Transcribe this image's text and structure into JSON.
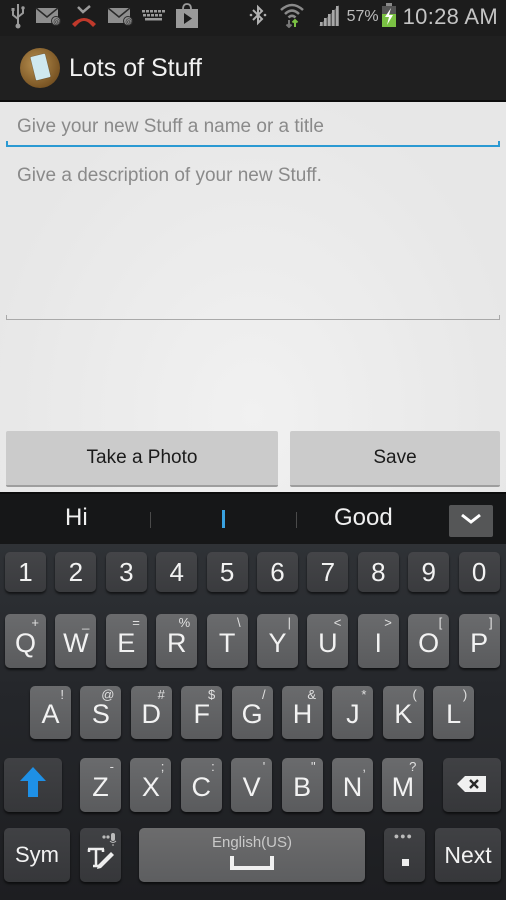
{
  "status_bar": {
    "left_icons": [
      "usb-icon",
      "email-icon",
      "missed-call-icon",
      "email-icon",
      "keyboard-icon",
      "play-store-icon"
    ],
    "right_icons": [
      "bluetooth-icon",
      "wifi-icon",
      "signal-icon",
      "battery-charging-icon"
    ],
    "battery_percent": "57%",
    "time": "10:28 AM",
    "colors": {
      "missed_call": "#c0392b",
      "battery": "#7ac143"
    }
  },
  "action_bar": {
    "title": "Lots of Stuff",
    "icon": "app-icon"
  },
  "form": {
    "title_field": {
      "value": "",
      "placeholder": "Give your new Stuff a name or a title",
      "focused": true
    },
    "description_field": {
      "value": "",
      "placeholder": "Give a description of your new Stuff."
    },
    "take_photo_label": "Take a Photo",
    "save_label": "Save",
    "accent_color": "#2b9ad3"
  },
  "suggestions": {
    "items": [
      "Hi",
      "I",
      "Good"
    ],
    "collapse_icon": "chevron-down-icon"
  },
  "keyboard": {
    "number_row": [
      "1",
      "2",
      "3",
      "4",
      "5",
      "6",
      "7",
      "8",
      "9",
      "0"
    ],
    "row1": [
      {
        "key": "Q",
        "sub": "+"
      },
      {
        "key": "W",
        "sub": "_"
      },
      {
        "key": "E",
        "sub": "="
      },
      {
        "key": "R",
        "sub": "%"
      },
      {
        "key": "T",
        "sub": "\\"
      },
      {
        "key": "Y",
        "sub": "|"
      },
      {
        "key": "U",
        "sub": "<"
      },
      {
        "key": "I",
        "sub": ">"
      },
      {
        "key": "O",
        "sub": "["
      },
      {
        "key": "P",
        "sub": "]"
      }
    ],
    "row2": [
      {
        "key": "A",
        "sub": "!"
      },
      {
        "key": "S",
        "sub": "@"
      },
      {
        "key": "D",
        "sub": "#"
      },
      {
        "key": "F",
        "sub": "$"
      },
      {
        "key": "G",
        "sub": "/"
      },
      {
        "key": "H",
        "sub": "&"
      },
      {
        "key": "J",
        "sub": "*"
      },
      {
        "key": "K",
        "sub": "("
      },
      {
        "key": "L",
        "sub": ")"
      }
    ],
    "row3": [
      {
        "key": "Z",
        "sub": "-"
      },
      {
        "key": "X",
        "sub": ";"
      },
      {
        "key": "C",
        "sub": ":"
      },
      {
        "key": "V",
        "sub": "'"
      },
      {
        "key": "B",
        "sub": "\""
      },
      {
        "key": "N",
        "sub": ","
      },
      {
        "key": "M",
        "sub": "?"
      }
    ],
    "sym_label": "Sym",
    "space_language": "English(US)",
    "period_label": ".",
    "next_label": "Next",
    "shift_color": "#1e90e6"
  }
}
